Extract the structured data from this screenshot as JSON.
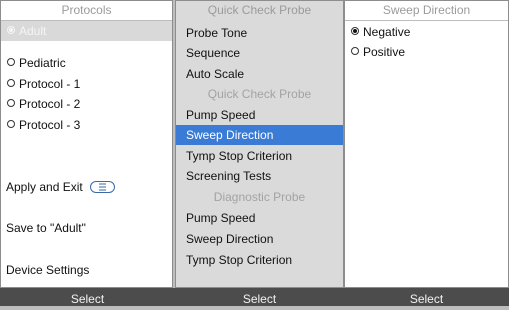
{
  "protocols": {
    "header": "Protocols",
    "items": [
      {
        "label": "Adult",
        "checked": true,
        "selected": true
      },
      {
        "label": "Pediatric",
        "checked": false,
        "selected": false
      },
      {
        "label": "Protocol - 1",
        "checked": false,
        "selected": false
      },
      {
        "label": "Protocol - 2",
        "checked": false,
        "selected": false
      },
      {
        "label": "Protocol - 3",
        "checked": false,
        "selected": false
      }
    ],
    "apply_label": "Apply and Exit",
    "save_label": "Save to \"Adult\"",
    "device_label": "Device Settings",
    "menu_key_icon": "menu-key-icon"
  },
  "settings": {
    "header": "Quick Check Probe",
    "items": [
      {
        "label": "Probe Tone",
        "type": "item"
      },
      {
        "label": "Sequence",
        "type": "item"
      },
      {
        "label": "Auto Scale",
        "type": "item"
      },
      {
        "label": "Quick Check Probe",
        "type": "subheader"
      },
      {
        "label": "Pump Speed",
        "type": "item"
      },
      {
        "label": "Sweep Direction",
        "type": "item",
        "selected": true
      },
      {
        "label": "Tymp Stop Criterion",
        "type": "item"
      },
      {
        "label": "Screening Tests",
        "type": "item"
      },
      {
        "label": "Diagnostic Probe",
        "type": "subheader"
      },
      {
        "label": "Pump Speed",
        "type": "item"
      },
      {
        "label": "Sweep Direction",
        "type": "item"
      },
      {
        "label": "Tymp Stop Criterion",
        "type": "item"
      }
    ]
  },
  "sweep": {
    "header": "Sweep Direction",
    "options": [
      {
        "label": "Negative",
        "checked": true
      },
      {
        "label": "Positive",
        "checked": false
      }
    ]
  },
  "footer": {
    "buttons": [
      "Select",
      "Select",
      "Select"
    ]
  },
  "colors": {
    "highlight": "#3a7bd5",
    "footer_bg": "#4c4c4c"
  }
}
